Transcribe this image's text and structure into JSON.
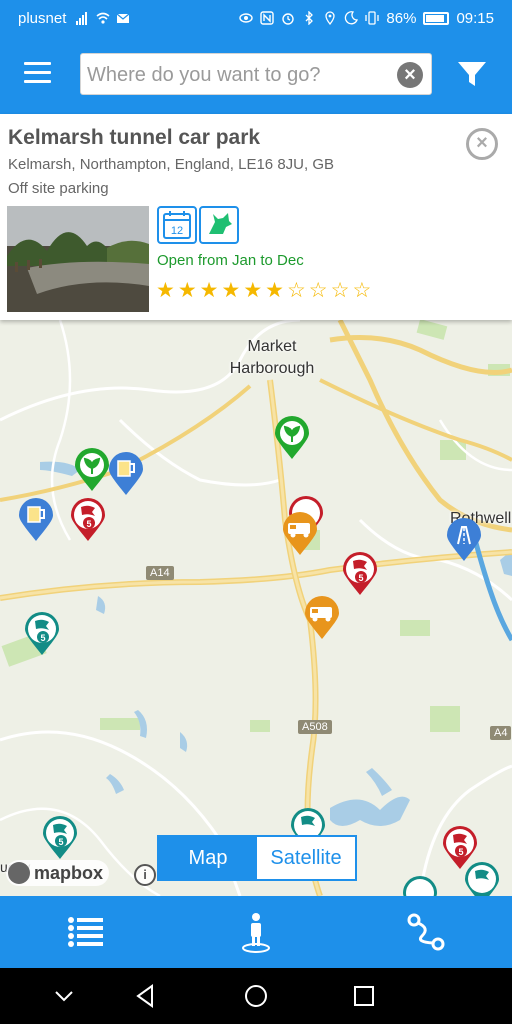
{
  "status_bar": {
    "carrier": "plusnet",
    "battery": "86%",
    "time": "09:15"
  },
  "header": {
    "menu_icon": "hamburger-menu-icon",
    "search_placeholder": "Where do you want to go?",
    "filter_icon": "filter-funnel-icon"
  },
  "place": {
    "title": "Kelmarsh tunnel car park",
    "address": "Kelmarsh, Northampton, England, LE16 8JU, GB",
    "type": "Off site parking",
    "calendar_day": "12",
    "opening": "Open from Jan to Dec",
    "rating": 6,
    "max_rating": 10,
    "features": [
      "calendar-icon",
      "dog-icon"
    ]
  },
  "map": {
    "towns": [
      "Market",
      "Harborough",
      "Rothwell"
    ],
    "roads": [
      "A14",
      "A508"
    ],
    "partial_town": "ugby",
    "marker_number": "5",
    "attribution": "mapbox",
    "toggle": {
      "map_label": "Map",
      "satellite_label": "Satellite",
      "selected": "Map"
    }
  },
  "bottom_nav": [
    "list-icon",
    "person-location-icon",
    "route-icon"
  ],
  "colors": {
    "primary": "#1e90ea",
    "green_open": "#1d9a2d",
    "star": "#f5b800"
  }
}
